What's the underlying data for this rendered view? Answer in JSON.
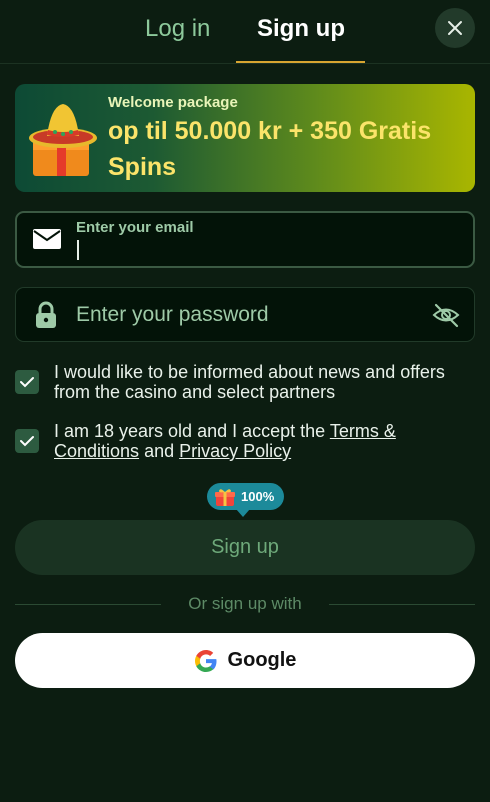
{
  "header": {
    "tabs": [
      {
        "label": "Log in",
        "active": false
      },
      {
        "label": "Sign up",
        "active": true
      }
    ],
    "close_icon": "close-icon"
  },
  "banner": {
    "kicker": "Welcome package",
    "amount": "op til 50.000 kr + 350 Gratis Spins",
    "art": "sombrero-gift-illustration"
  },
  "form": {
    "email": {
      "label": "Enter your email",
      "value": "",
      "icon": "mail-icon"
    },
    "password": {
      "placeholder": "Enter your password",
      "value": "",
      "icon": "lock-icon",
      "toggle_icon": "eye-off-icon"
    },
    "checkboxes": [
      {
        "checked": true,
        "text": "I would like to be informed about news and offers from the casino and select partners"
      },
      {
        "checked": true,
        "text_before": "I am 18 years old and I accept the ",
        "link1": "Terms & Conditions",
        "text_middle": " and ",
        "link2": "Privacy Policy"
      }
    ],
    "badge": {
      "percent": "100%",
      "icon": "gift-icon"
    },
    "submit_label": "Sign up"
  },
  "social": {
    "divider_text": "Or sign up with",
    "google_label": "Google"
  },
  "colors": {
    "background": "#0c1d11",
    "accent_underline": "#d8a531",
    "banner_text": "#fbe46a",
    "checkbox": "#2d5b40",
    "badge": "#1c8a9a"
  }
}
